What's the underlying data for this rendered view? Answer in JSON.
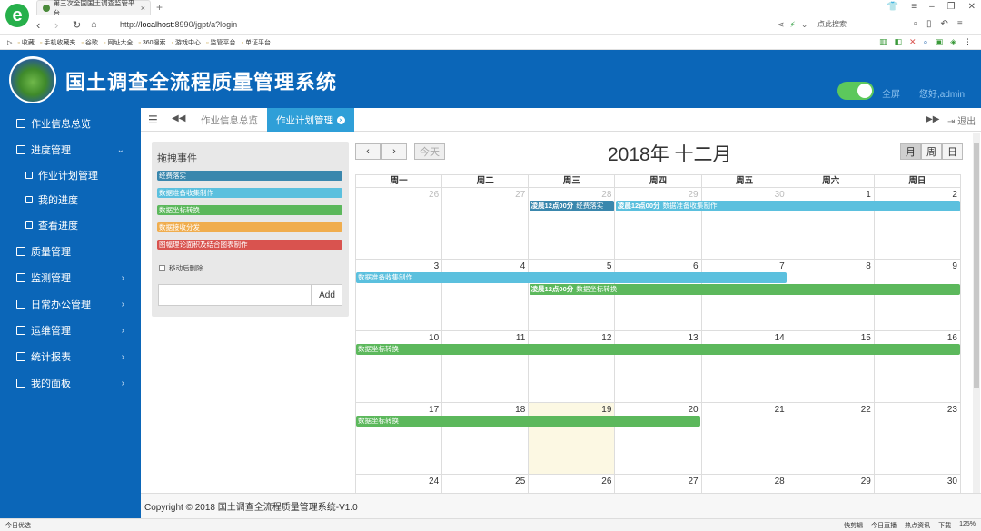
{
  "browser": {
    "tab_title": "第三次全国国土调查监管平台",
    "new_tab": "+",
    "url_prefix": "http://",
    "url_host": "localhost",
    "url_rest": ":8990/jgpt/a?login",
    "search_placeholder": "点此搜索",
    "bookmarks": [
      "收藏",
      "手机收藏夹",
      "谷歌",
      "网址大全",
      "360搜索",
      "游戏中心",
      "监管平台",
      "单证平台"
    ],
    "status_left": "今日优选",
    "status_right": [
      "快剪辑",
      "今日直播",
      "热点资讯",
      "下载",
      "125%"
    ]
  },
  "header": {
    "title": "国土调查全流程质量管理系统",
    "fullscreen_label": "全屏",
    "greeting": "您好,admin"
  },
  "sidebar": {
    "items": [
      {
        "label": "作业信息总览",
        "icon": "desktop-icon"
      },
      {
        "label": "进度管理",
        "icon": "laptop-icon",
        "arrow": "⌄"
      },
      {
        "label": "作业计划管理",
        "icon": "list-icon"
      },
      {
        "label": "我的进度",
        "icon": "list-icon"
      },
      {
        "label": "查看进度",
        "icon": "list-icon"
      },
      {
        "label": "质量管理",
        "icon": "grid-icon"
      },
      {
        "label": "监测管理",
        "icon": "film-icon",
        "arrow": "›"
      },
      {
        "label": "日常办公管理",
        "icon": "inbox-icon",
        "arrow": "›"
      },
      {
        "label": "运维管理",
        "icon": "table-icon",
        "arrow": "›"
      },
      {
        "label": "统计报表",
        "icon": "chart-icon",
        "arrow": "›"
      },
      {
        "label": "我的面板",
        "icon": "columns-icon",
        "arrow": "›"
      }
    ]
  },
  "tabbar": {
    "tabs": [
      "作业信息总览",
      "作业计划管理"
    ],
    "active_tab": "作业计划管理",
    "exit_label": "退出"
  },
  "events_panel": {
    "title": "拖拽事件",
    "events": [
      {
        "label": "经费落实",
        "color": "#3a87ad"
      },
      {
        "label": "数据准备收集制作",
        "color": "#5bc0de"
      },
      {
        "label": "数据坐标转换",
        "color": "#5cb85c"
      },
      {
        "label": "数据接收分发",
        "color": "#f0ad4e"
      },
      {
        "label": "图幅理论面积及结合图表制作",
        "color": "#d9534f"
      }
    ],
    "remove_after_drop_label": "移动后删除",
    "add_button": "Add"
  },
  "calendar": {
    "prev": "‹",
    "next": "›",
    "today_label": "今天",
    "title": "2018年 十二月",
    "views": [
      "月",
      "周",
      "日"
    ],
    "active_view": "月",
    "weekdays": [
      "周一",
      "周二",
      "周三",
      "周四",
      "周五",
      "周六",
      "周日"
    ],
    "weeks": [
      [
        {
          "d": "26",
          "other": true
        },
        {
          "d": "27",
          "other": true
        },
        {
          "d": "28",
          "other": true
        },
        {
          "d": "29",
          "other": true
        },
        {
          "d": "30",
          "other": true
        },
        {
          "d": "1"
        },
        {
          "d": "2"
        }
      ],
      [
        {
          "d": "3"
        },
        {
          "d": "4"
        },
        {
          "d": "5"
        },
        {
          "d": "6"
        },
        {
          "d": "7"
        },
        {
          "d": "8"
        },
        {
          "d": "9"
        }
      ],
      [
        {
          "d": "10"
        },
        {
          "d": "11"
        },
        {
          "d": "12"
        },
        {
          "d": "13"
        },
        {
          "d": "14"
        },
        {
          "d": "15"
        },
        {
          "d": "16"
        }
      ],
      [
        {
          "d": "17"
        },
        {
          "d": "18"
        },
        {
          "d": "19",
          "today": true
        },
        {
          "d": "20"
        },
        {
          "d": "21"
        },
        {
          "d": "22"
        },
        {
          "d": "23"
        }
      ],
      [
        {
          "d": "24"
        },
        {
          "d": "25"
        },
        {
          "d": "26"
        },
        {
          "d": "27"
        },
        {
          "d": "28"
        },
        {
          "d": "29"
        },
        {
          "d": "30"
        }
      ]
    ],
    "events": [
      {
        "week": 0,
        "start": 2,
        "end": 2,
        "lane": 0,
        "time": "凌晨12点00分",
        "title": "经费落实",
        "color": "#3a87ad"
      },
      {
        "week": 0,
        "start": 3,
        "end": 6,
        "lane": 0,
        "time": "凌晨12点00分",
        "title": "数据准备收集制作",
        "color": "#5bc0de"
      },
      {
        "week": 1,
        "start": 0,
        "end": 4,
        "lane": 0,
        "time": "",
        "title": "数据准备收集制作",
        "color": "#5bc0de"
      },
      {
        "week": 1,
        "start": 2,
        "end": 6,
        "lane": 1,
        "time": "凌晨12点00分",
        "title": "数据坐标转换",
        "color": "#5cb85c"
      },
      {
        "week": 2,
        "start": 0,
        "end": 6,
        "lane": 0,
        "time": "",
        "title": "数据坐标转换",
        "color": "#5cb85c"
      },
      {
        "week": 3,
        "start": 0,
        "end": 3,
        "lane": 0,
        "time": "",
        "title": "数据坐标转换",
        "color": "#5cb85c"
      }
    ]
  },
  "footer": {
    "copyright": "Copyright © 2018 国土调查全流程质量管理系统-V1.0"
  }
}
